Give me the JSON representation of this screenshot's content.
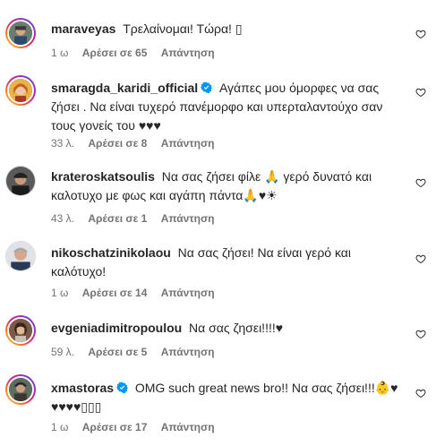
{
  "comments": [
    {
      "username": "maraveyas",
      "verified": false,
      "text": "Τρελαίνομαι! Τώρα! ▯",
      "time": "1 ω",
      "likes": "Αρέσει σε 65",
      "reply": "Απάντηση"
    },
    {
      "username": "smaragda_karidi_official",
      "verified": true,
      "text": "Αγάπες μου όμορφες να σας ζήσει . Να είναι τυχερό πανέμορφο και υπερταλαντούχο σαν τους γονείς του ♥♥♥",
      "time": "33 λ.",
      "likes": "Αρέσει σε 8",
      "reply": "Απάντηση"
    },
    {
      "username": "krateroskatsoulis",
      "verified": false,
      "text": "Να σας ζήσει φίλε 🙏 γερό δυνατό και καλοτυχο με φως και αγάπη πάντα🙏♥☀",
      "time": "43 λ.",
      "likes": "Αρέσει σε 1",
      "reply": "Απάντηση"
    },
    {
      "username": "nikoschatzinikolaou",
      "verified": false,
      "text": "Να σας ζήσει! Να είναι γερό και καλότυχο!",
      "time": "1 ω",
      "likes": "Αρέσει σε 14",
      "reply": "Απάντηση"
    },
    {
      "username": "evgeniadimitropoulou",
      "verified": false,
      "text": "Να σας ζησει!!!!♥",
      "time": "59 λ.",
      "likes": "Αρέσει σε 5",
      "reply": "Απάντηση"
    },
    {
      "username": "xmastoras",
      "verified": true,
      "text": "OMG such great news bro!! Να σας ζήσει!!!👶♥ ♥♥♥♥▯▯▯",
      "time": "1 ω",
      "likes": "Αρέσει σε 17",
      "reply": "Απάντηση"
    }
  ],
  "colors": {
    "text": "#262626",
    "secondary": "#737373",
    "verified_blue": "#0095f6"
  },
  "icons": {
    "verified": "verified-badge-icon",
    "like": "heart-outline-icon"
  }
}
